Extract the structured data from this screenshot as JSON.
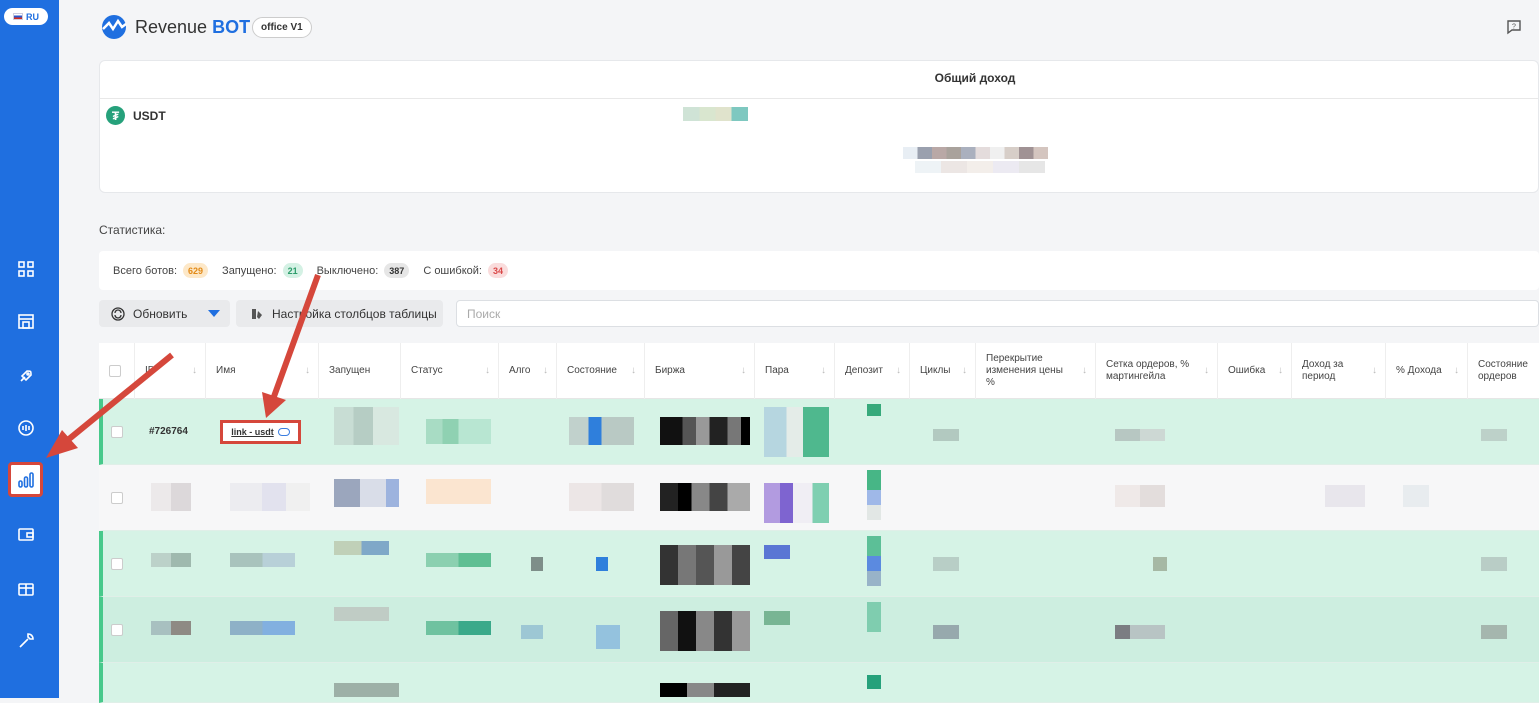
{
  "sidebar": {
    "language": "RU",
    "items": [
      {
        "name": "dashboard-icon"
      },
      {
        "name": "store-icon"
      },
      {
        "name": "rocket-icon"
      },
      {
        "name": "bot-icon"
      },
      {
        "name": "statistics-icon",
        "active": true
      },
      {
        "name": "wallet-icon"
      },
      {
        "name": "gift-icon"
      },
      {
        "name": "wrench-icon"
      }
    ]
  },
  "header": {
    "brand_revenue": "Revenue",
    "brand_bot": "BOT",
    "office_label": "office V1"
  },
  "income": {
    "title": "Общий доход",
    "currency": "USDT",
    "currency_icon": "₮"
  },
  "stats": {
    "label": "Статистика:",
    "total_label": "Всего ботов:",
    "total_value": "629",
    "running_label": "Запущено:",
    "running_value": "21",
    "off_label": "Выключено:",
    "off_value": "387",
    "error_label": "С ошибкой:",
    "error_value": "34"
  },
  "toolbar": {
    "update_label": "Обновить",
    "columns_label": "Настройка столбцов таблицы",
    "search_placeholder": "Поиск"
  },
  "table": {
    "columns": {
      "id": "ID",
      "name": "Имя",
      "started": "Запущен",
      "status": "Статус",
      "algo": "Алго",
      "state": "Состояние",
      "exchange": "Биржа",
      "pair": "Пара",
      "deposit": "Депозит",
      "cycles": "Циклы",
      "overlap": "Перекрытие изменения цены %",
      "grid": "Сетка ордеров, % мартингейла",
      "error": "Ошибка",
      "income_period": "Доход за период",
      "income_pct": "% Дохода",
      "orders_state": "Состояние ордеров"
    },
    "first_row": {
      "id": "#726764",
      "name": "link - usdt"
    }
  },
  "colors": {
    "sidebar": "#1f6fe0",
    "highlight": "#d5473b",
    "running_row": "#d6f3e6"
  }
}
